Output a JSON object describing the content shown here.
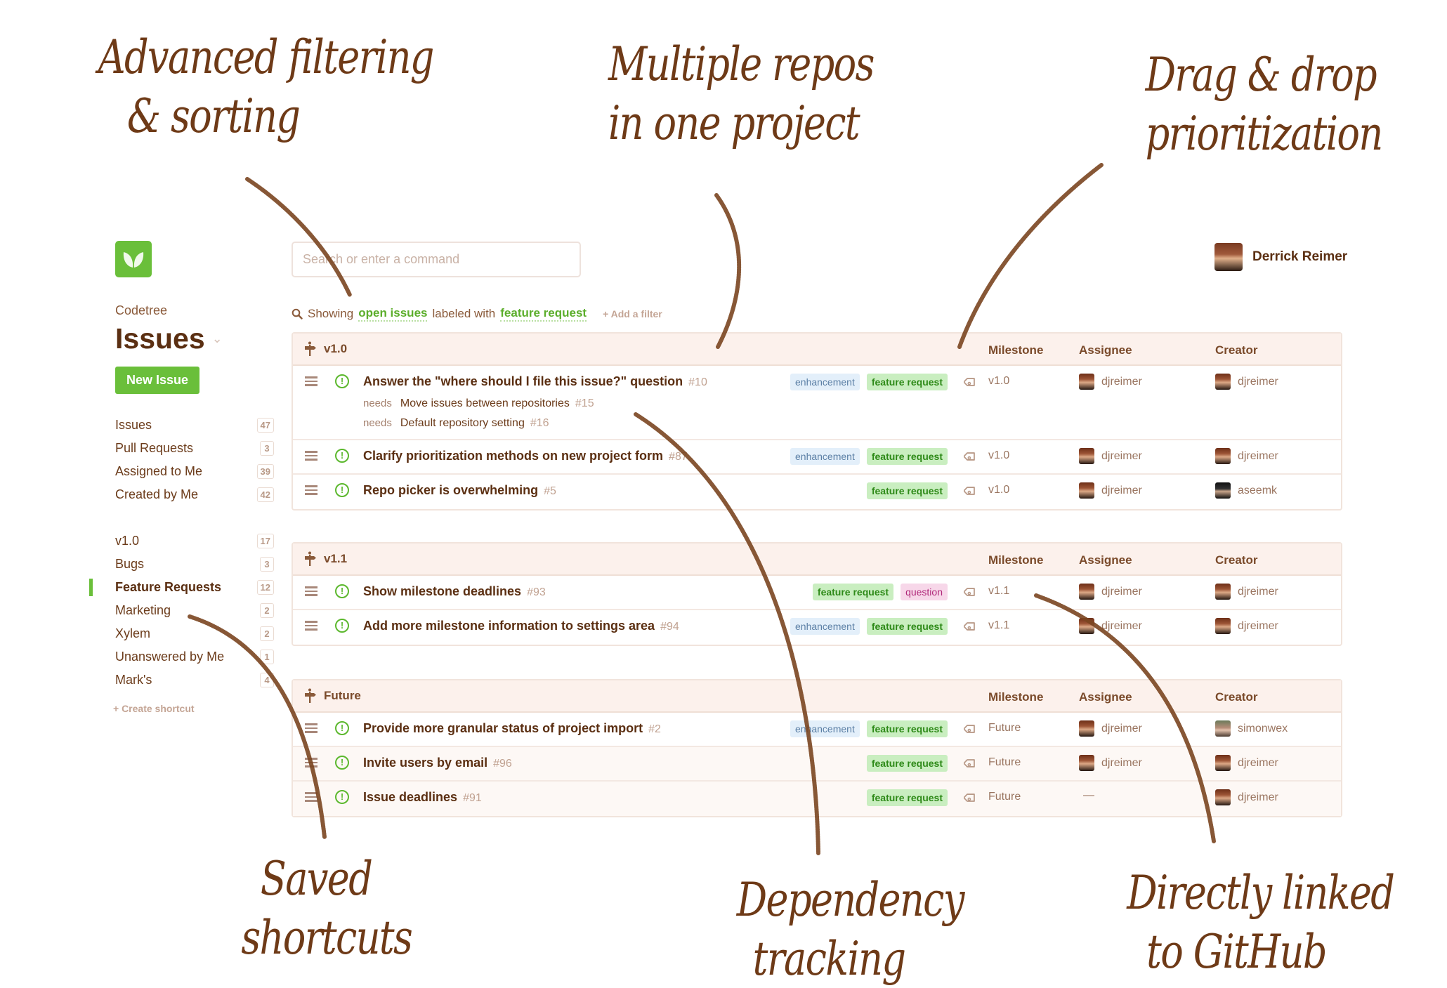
{
  "annotations": {
    "filtering": [
      "Advanced filtering",
      "& sorting"
    ],
    "repos": [
      "Multiple repos",
      "in one project"
    ],
    "drag": [
      "Drag & drop",
      "prioritization"
    ],
    "shortcuts": [
      "Saved",
      "shortcuts"
    ],
    "dependency": [
      "Dependency",
      "tracking"
    ],
    "github": [
      "Directly linked",
      "to GitHub"
    ]
  },
  "app": {
    "logo": "leaf-icon",
    "search": {
      "placeholder": "Search or enter a command",
      "value": ""
    },
    "user": {
      "name": "Derrick Reimer"
    },
    "brand": "Codetree",
    "page_title": "Issues",
    "new_issue_label": "New Issue",
    "accent_color": "#6abf3a"
  },
  "sidebar": {
    "groups": [
      [
        {
          "label": "Issues",
          "count": "47"
        },
        {
          "label": "Pull Requests",
          "count": "3"
        },
        {
          "label": "Assigned to Me",
          "count": "39"
        },
        {
          "label": "Created by Me",
          "count": "42"
        }
      ],
      [
        {
          "label": "v1.0",
          "count": "17"
        },
        {
          "label": "Bugs",
          "count": "3"
        },
        {
          "label": "Feature Requests",
          "count": "12",
          "active": true
        },
        {
          "label": "Marketing",
          "count": "2"
        },
        {
          "label": "Xylem",
          "count": "2"
        },
        {
          "label": "Unanswered by Me",
          "count": "1"
        },
        {
          "label": "Mark's",
          "count": "4"
        }
      ]
    ],
    "create_shortcut": "+ Create shortcut"
  },
  "filter": {
    "prefix": "Showing",
    "state": "open issues",
    "middle": "labeled with",
    "label": "feature request",
    "add_filter": "+ Add a filter"
  },
  "columns": {
    "milestone": "Milestone",
    "assignee": "Assignee",
    "creator": "Creator"
  },
  "groups": [
    {
      "title": "v1.0",
      "issues": [
        {
          "title": "Answer the \"where should I file this issue?\" question",
          "number": "#10",
          "labels": [
            "enhancement",
            "feature request"
          ],
          "milestone": "v1.0",
          "assignee": "djreimer",
          "creator": "djreimer",
          "deps": [
            {
              "prefix": "needs",
              "title": "Move issues between repositories",
              "number": "#15"
            },
            {
              "prefix": "needs",
              "title": "Default repository setting",
              "number": "#16"
            }
          ]
        },
        {
          "title": "Clarify prioritization methods on new project form",
          "number": "#87",
          "labels": [
            "enhancement",
            "feature request"
          ],
          "milestone": "v1.0",
          "assignee": "djreimer",
          "creator": "djreimer"
        },
        {
          "title": "Repo picker is overwhelming",
          "number": "#5",
          "labels": [
            "feature request"
          ],
          "milestone": "v1.0",
          "assignee": "djreimer",
          "creator": "aseemk"
        }
      ]
    },
    {
      "title": "v1.1",
      "issues": [
        {
          "title": "Show milestone deadlines",
          "number": "#93",
          "labels": [
            "feature request",
            "question"
          ],
          "milestone": "v1.1",
          "assignee": "djreimer",
          "creator": "djreimer"
        },
        {
          "title": "Add more milestone information to settings area",
          "number": "#94",
          "labels": [
            "enhancement",
            "feature request"
          ],
          "milestone": "v1.1",
          "assignee": "djreimer",
          "creator": "djreimer"
        }
      ]
    },
    {
      "title": "Future",
      "issues": [
        {
          "title": "Provide more granular status of project import",
          "number": "#2",
          "labels": [
            "enhancement",
            "feature request"
          ],
          "milestone": "Future",
          "assignee": "djreimer",
          "creator": "simonwex"
        },
        {
          "title": "Invite users by email",
          "number": "#96",
          "labels": [
            "feature request"
          ],
          "milestone": "Future",
          "assignee": "djreimer",
          "creator": "djreimer",
          "muted": true
        },
        {
          "title": "Issue deadlines",
          "number": "#91",
          "labels": [
            "feature request"
          ],
          "milestone": "Future",
          "assignee": "—",
          "creator": "djreimer",
          "muted": true
        }
      ]
    }
  ]
}
